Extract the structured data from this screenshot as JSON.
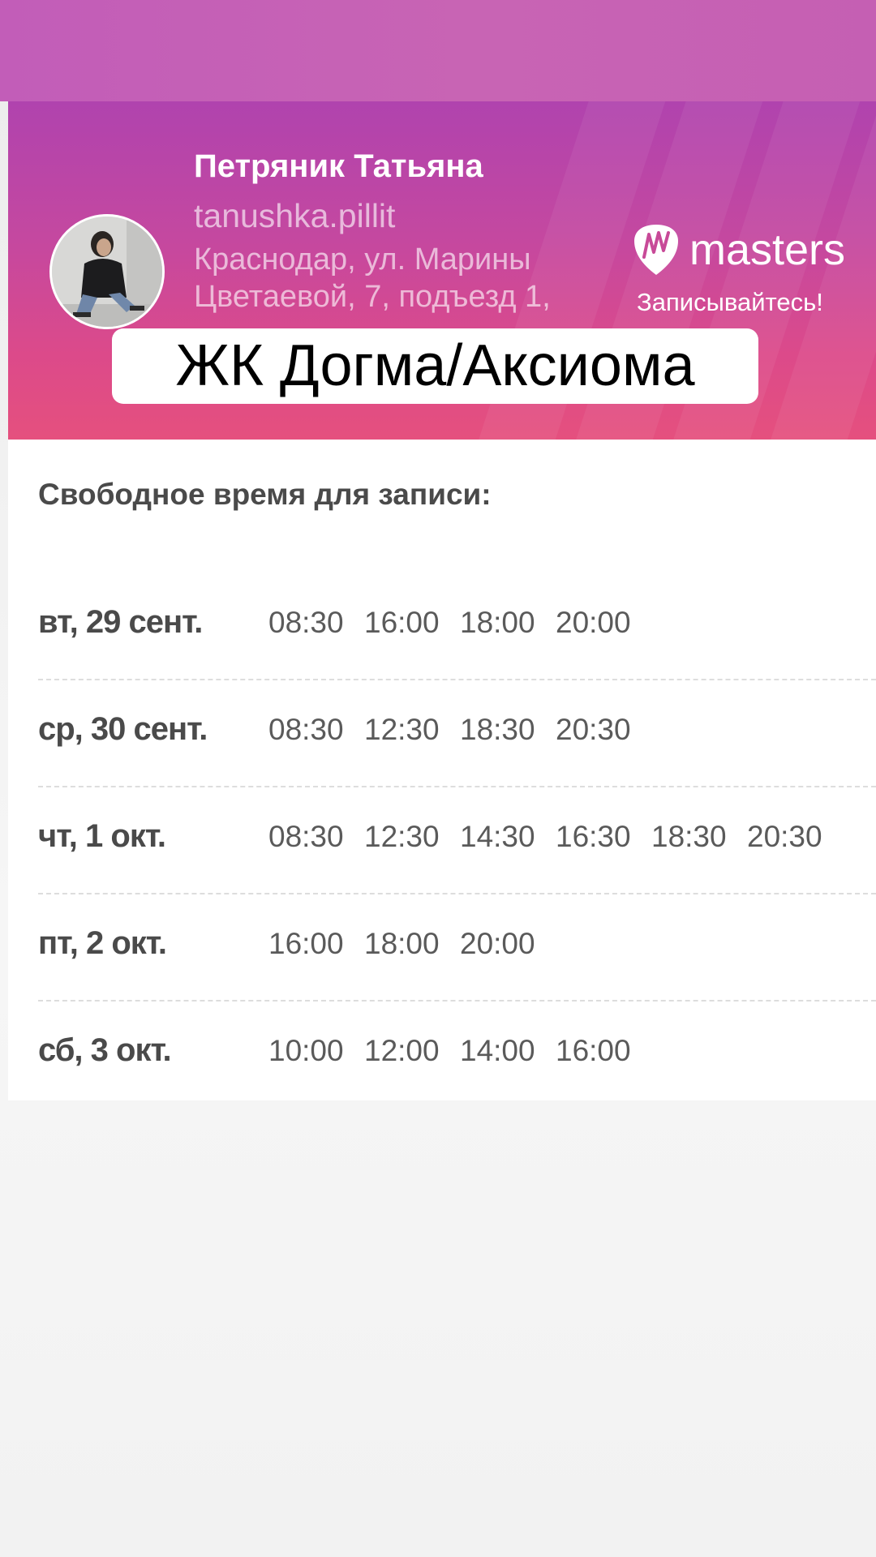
{
  "master": {
    "name": "Петряник Татьяна",
    "handle": "tanushka.pillit",
    "address": "Краснодар, ул. Марины Цветаевой, 7, подъезд 1,"
  },
  "brand": {
    "logo_text": "masters",
    "cta": "Записывайтесь!"
  },
  "overlay_label": "ЖК Догма/Аксиома",
  "schedule": {
    "title": "Свободное время для записи:",
    "days": [
      {
        "label": "вт, 29 сент.",
        "slots": [
          "08:30",
          "16:00",
          "18:00",
          "20:00"
        ]
      },
      {
        "label": "ср, 30 сент.",
        "slots": [
          "08:30",
          "12:30",
          "18:30",
          "20:30"
        ]
      },
      {
        "label": "чт, 1 окт.",
        "slots": [
          "08:30",
          "12:30",
          "14:30",
          "16:30",
          "18:30",
          "20:30"
        ]
      },
      {
        "label": "пт, 2 окт.",
        "slots": [
          "16:00",
          "18:00",
          "20:00"
        ]
      },
      {
        "label": "сб, 3 окт.",
        "slots": [
          "10:00",
          "12:00",
          "14:00",
          "16:00"
        ]
      }
    ]
  },
  "colors": {
    "header_top": "#b043ae",
    "header_bottom": "#e5507e",
    "strip": "#c864b4",
    "text_dark": "#4a4a4a"
  }
}
